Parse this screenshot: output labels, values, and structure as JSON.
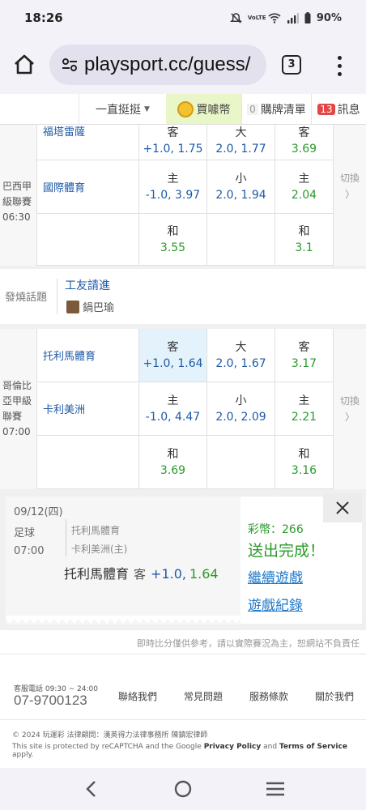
{
  "statusbar": {
    "time": "18:26",
    "battery": "90%",
    "net": "VoLTE"
  },
  "browser": {
    "url": "playsport.cc/guess/",
    "tab_count": "3"
  },
  "nav": {
    "item1": "一直挺挺",
    "item2": "買噱幣",
    "item3_count": "0",
    "item3": "購牌清單",
    "item4_count": "13",
    "item4": "訊息"
  },
  "match1": {
    "league": [
      "巴西甲",
      "級聯賽",
      "06:30"
    ],
    "team_away": "福塔雷薩",
    "team_home": "國際體育",
    "away_spread": {
      "label": "客",
      "value": "+1.0, 1.75"
    },
    "away_total": {
      "label": "大",
      "value": "2.0, 1.77"
    },
    "away_ml": {
      "label": "客",
      "value": "3.69"
    },
    "home_spread": {
      "label": "主",
      "value": "-1.0, 3.97"
    },
    "home_total": {
      "label": "小",
      "value": "2.0, 1.94"
    },
    "home_ml": {
      "label": "主",
      "value": "2.04"
    },
    "draw_spread": {
      "label": "和",
      "value": "3.55"
    },
    "draw_ml": {
      "label": "和",
      "value": "3.1"
    },
    "switch": "切換",
    "switch_arrow": "〉"
  },
  "hot": {
    "label": "發燒話題",
    "title": "工友請進",
    "author": "鍋巴瑜"
  },
  "match2": {
    "league": [
      "哥倫比",
      "亞甲級",
      "聯賽",
      "07:00"
    ],
    "team_away": "托利馬體育",
    "team_home": "卡利美洲",
    "away_spread": {
      "label": "客",
      "value": "+1.0, 1.64"
    },
    "away_total": {
      "label": "大",
      "value": "2.0, 1.67"
    },
    "away_ml": {
      "label": "客",
      "value": "3.17"
    },
    "home_spread": {
      "label": "主",
      "value": "-1.0, 4.47"
    },
    "home_total": {
      "label": "小",
      "value": "2.0, 2.09"
    },
    "home_ml": {
      "label": "主",
      "value": "2.21"
    },
    "draw_spread": {
      "label": "和",
      "value": "3.69"
    },
    "draw_ml": {
      "label": "和",
      "value": "3.16"
    },
    "switch": "切換",
    "switch_arrow": "〉"
  },
  "popup": {
    "date": "09/12(四)",
    "sport": "足球",
    "time": "07:00",
    "team1": "托利馬體育",
    "team2": "卡利美洲(主)",
    "pick_team": "托利馬體育",
    "pick_kind": "客",
    "pick_line": "+1.0,",
    "pick_odds": "1.64",
    "coins": "彩幣：266",
    "done": "送出完成！",
    "continue": "繼續遊戲",
    "history": "遊戲紀錄"
  },
  "disclaimer": "即時比分僅供參考，請以實際賽況為主，恕網站不負責任",
  "footer": {
    "service_hours": "客服電話 09:30 ~ 24:00",
    "phone": "07-9700123",
    "links": [
      "聯絡我們",
      "常見問題",
      "服務條款",
      "關於我們"
    ],
    "copyright": "© 2024 玩運彩 法律顧問：漢英得力法律事務所 陳鎮宏律師",
    "recaptcha_pre": "This site is protected by reCAPTCHA and the Google",
    "privacy": "Privacy Policy",
    "and": "and",
    "terms": "Terms of Service",
    "apply": "apply."
  }
}
